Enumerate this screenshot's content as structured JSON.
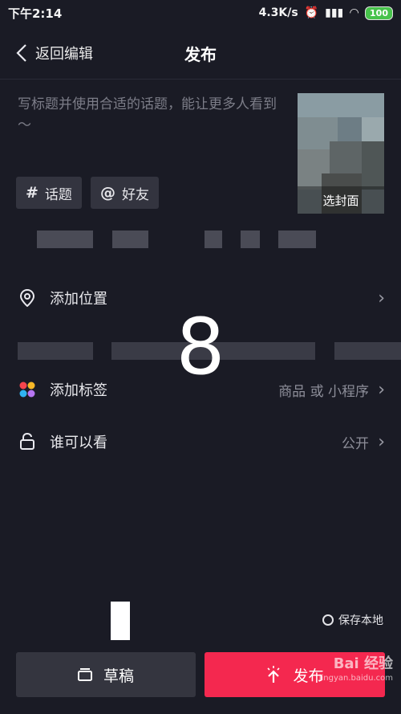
{
  "status_bar": {
    "time": "下午2:14",
    "speed": "4.3K/s",
    "battery": "100"
  },
  "header": {
    "back_label": "返回编辑",
    "title": "发布"
  },
  "caption": {
    "placeholder": "写标题并使用合适的话题，能让更多人看到～"
  },
  "cover": {
    "label": "选封面"
  },
  "chips": {
    "topic_symbol": "#",
    "topic_label": "话题",
    "friend_symbol": "@",
    "friend_label": "好友"
  },
  "rows": {
    "location": {
      "label": "添加位置"
    },
    "tags": {
      "label": "添加标签",
      "value": "商品 或 小程序"
    },
    "visibility": {
      "label": "谁可以看",
      "value": "公开"
    }
  },
  "overlay_number": "8",
  "save_local": {
    "label": "保存本地"
  },
  "buttons": {
    "draft": "草稿",
    "publish": "发布"
  },
  "watermark": {
    "brand": "Bai 经验",
    "url": "jingyan.baidu.com"
  },
  "colors": {
    "background": "#1a1b25",
    "publish": "#f4284f",
    "draft": "#34353f"
  }
}
